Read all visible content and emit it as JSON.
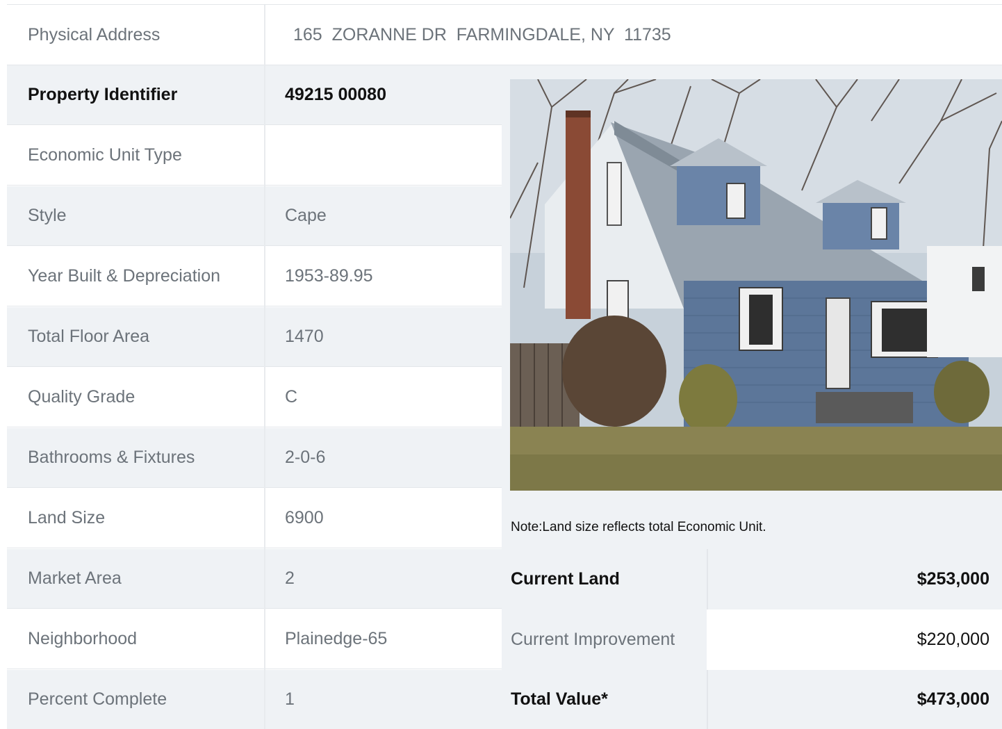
{
  "address": {
    "label": "Physical Address",
    "value": "165  ZORANNE DR  FARMINGDALE, NY  11735"
  },
  "details": [
    {
      "label": "Property Identifier",
      "value": "49215  00080"
    },
    {
      "label": "Economic Unit Type",
      "value": ""
    },
    {
      "label": "Style",
      "value": "Cape"
    },
    {
      "label": "Year Built & Depreciation",
      "value": "1953-89.95"
    },
    {
      "label": "Total Floor Area",
      "value": "1470"
    },
    {
      "label": "Quality Grade",
      "value": "C"
    },
    {
      "label": "Bathrooms & Fixtures",
      "value": "2-0-6"
    },
    {
      "label": "Land Size",
      "value": "6900"
    },
    {
      "label": "Market Area",
      "value": "2"
    },
    {
      "label": "Neighborhood",
      "value": "Plainedge-65"
    },
    {
      "label": "Percent Complete",
      "value": "1"
    }
  ],
  "note": "Note:Land size reflects total Economic Unit.",
  "valuation": {
    "current_land": {
      "label": "Current Land",
      "value": "$253,000"
    },
    "current_improvement": {
      "label": "Current Improvement",
      "value": "$220,000"
    },
    "total_value": {
      "label": "Total Value*",
      "value": "$473,000"
    }
  },
  "colors": {
    "shade": "#eff2f5",
    "text_muted": "#6c737a",
    "text_strong": "#111111"
  }
}
